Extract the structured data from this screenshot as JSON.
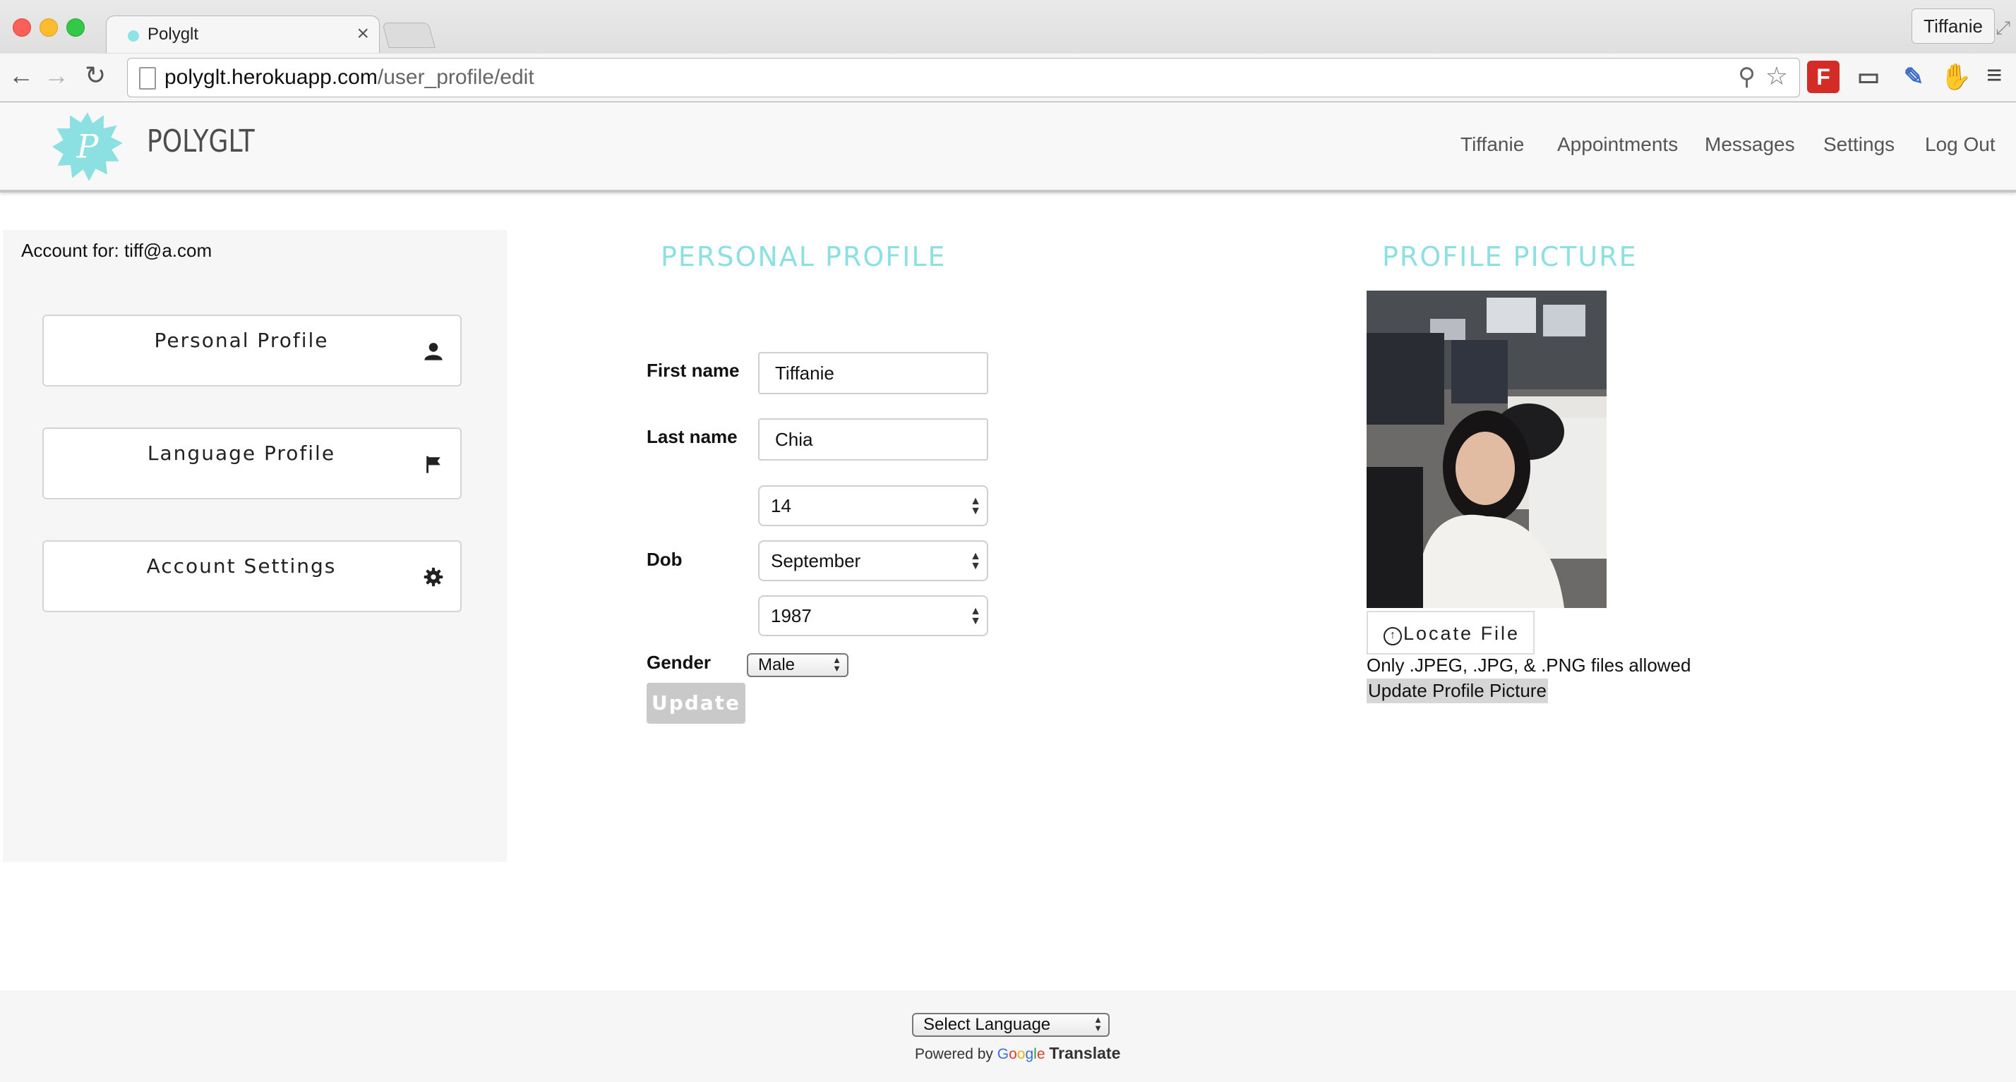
{
  "browser": {
    "tab_title": "Polyglt",
    "tab_close": "×",
    "profile_name": "Tiffanie",
    "url_host": "polyglt.herokuapp.com",
    "url_path": "/user_profile/edit",
    "extension_badge": "F"
  },
  "header": {
    "brand": "POLYGLT",
    "logo_letter": "P",
    "nav": [
      "Tiffanie",
      "Appointments",
      "Messages",
      "Settings",
      "Log Out"
    ]
  },
  "sidebar": {
    "account_label": "Account for: tiff@a.com",
    "items": [
      {
        "label": "Personal Profile",
        "icon": "user-icon"
      },
      {
        "label": "Language Profile",
        "icon": "flag-icon"
      },
      {
        "label": "Account Settings",
        "icon": "gear-icon"
      }
    ]
  },
  "personal_profile": {
    "title": "PERSONAL PROFILE",
    "first_name_label": "First name",
    "first_name": "Tiffanie",
    "last_name_label": "Last name",
    "last_name": "Chia",
    "dob_label": "Dob",
    "dob_day": "14",
    "dob_month": "September",
    "dob_year": "1987",
    "gender_label": "Gender",
    "gender": "Male",
    "update_label": "Update"
  },
  "profile_picture": {
    "title": "PROFILE PICTURE",
    "locate_label": "Locate File",
    "allowed_text": "Only .JPEG, .JPG, & .PNG files allowed",
    "update_label": "Update Profile Picture"
  },
  "footer": {
    "language_select": "Select Language",
    "powered_by": "Powered by",
    "google_letters": [
      "G",
      "o",
      "o",
      "g",
      "l",
      "e"
    ],
    "translate": "Translate"
  },
  "colors": {
    "accent": "#8de0e2",
    "update_disabled": "#c9c9c9"
  }
}
